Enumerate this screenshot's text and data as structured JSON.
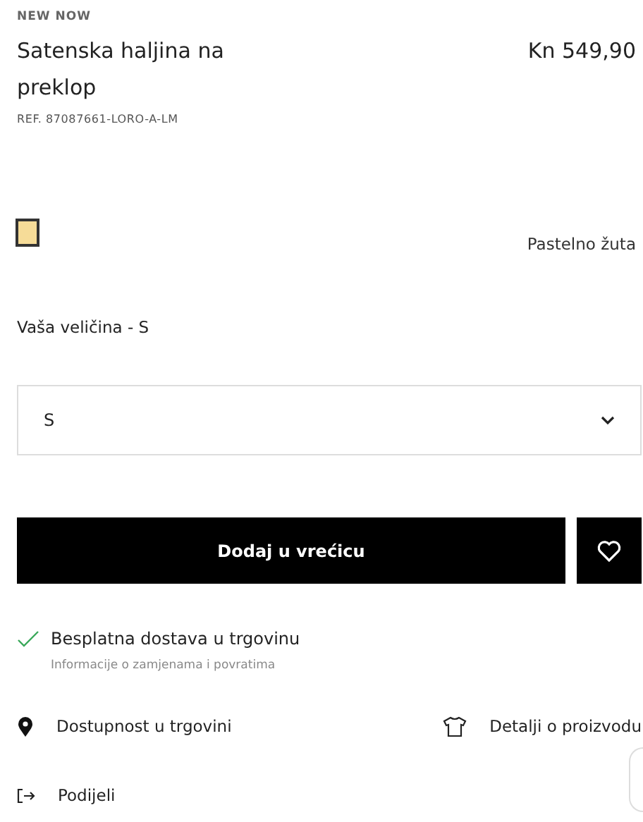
{
  "product": {
    "badge": "NEW NOW",
    "title": "Satenska haljina na preklop",
    "price": "Kn 549,90",
    "reference": "REF. 87087661-LORO-A-LM"
  },
  "colors": [
    {
      "name": "Pastelno žuta",
      "color": "#f6dc98",
      "selected": true
    }
  ],
  "size": {
    "label": "Vaša veličina - S",
    "value": "S"
  },
  "actions": {
    "add_to_bag": "Dodaj u vrećicu"
  },
  "delivery": {
    "title": "Besplatna dostava u trgovinu",
    "subtitle": "Informacije o zamjenama i povratima"
  },
  "links": [
    {
      "kind": "pin",
      "label": "Dostupnost u trgovini"
    },
    {
      "kind": "shirt",
      "label": "Detalji o proizvodu"
    },
    {
      "kind": "share",
      "label": "Podijeli"
    }
  ]
}
